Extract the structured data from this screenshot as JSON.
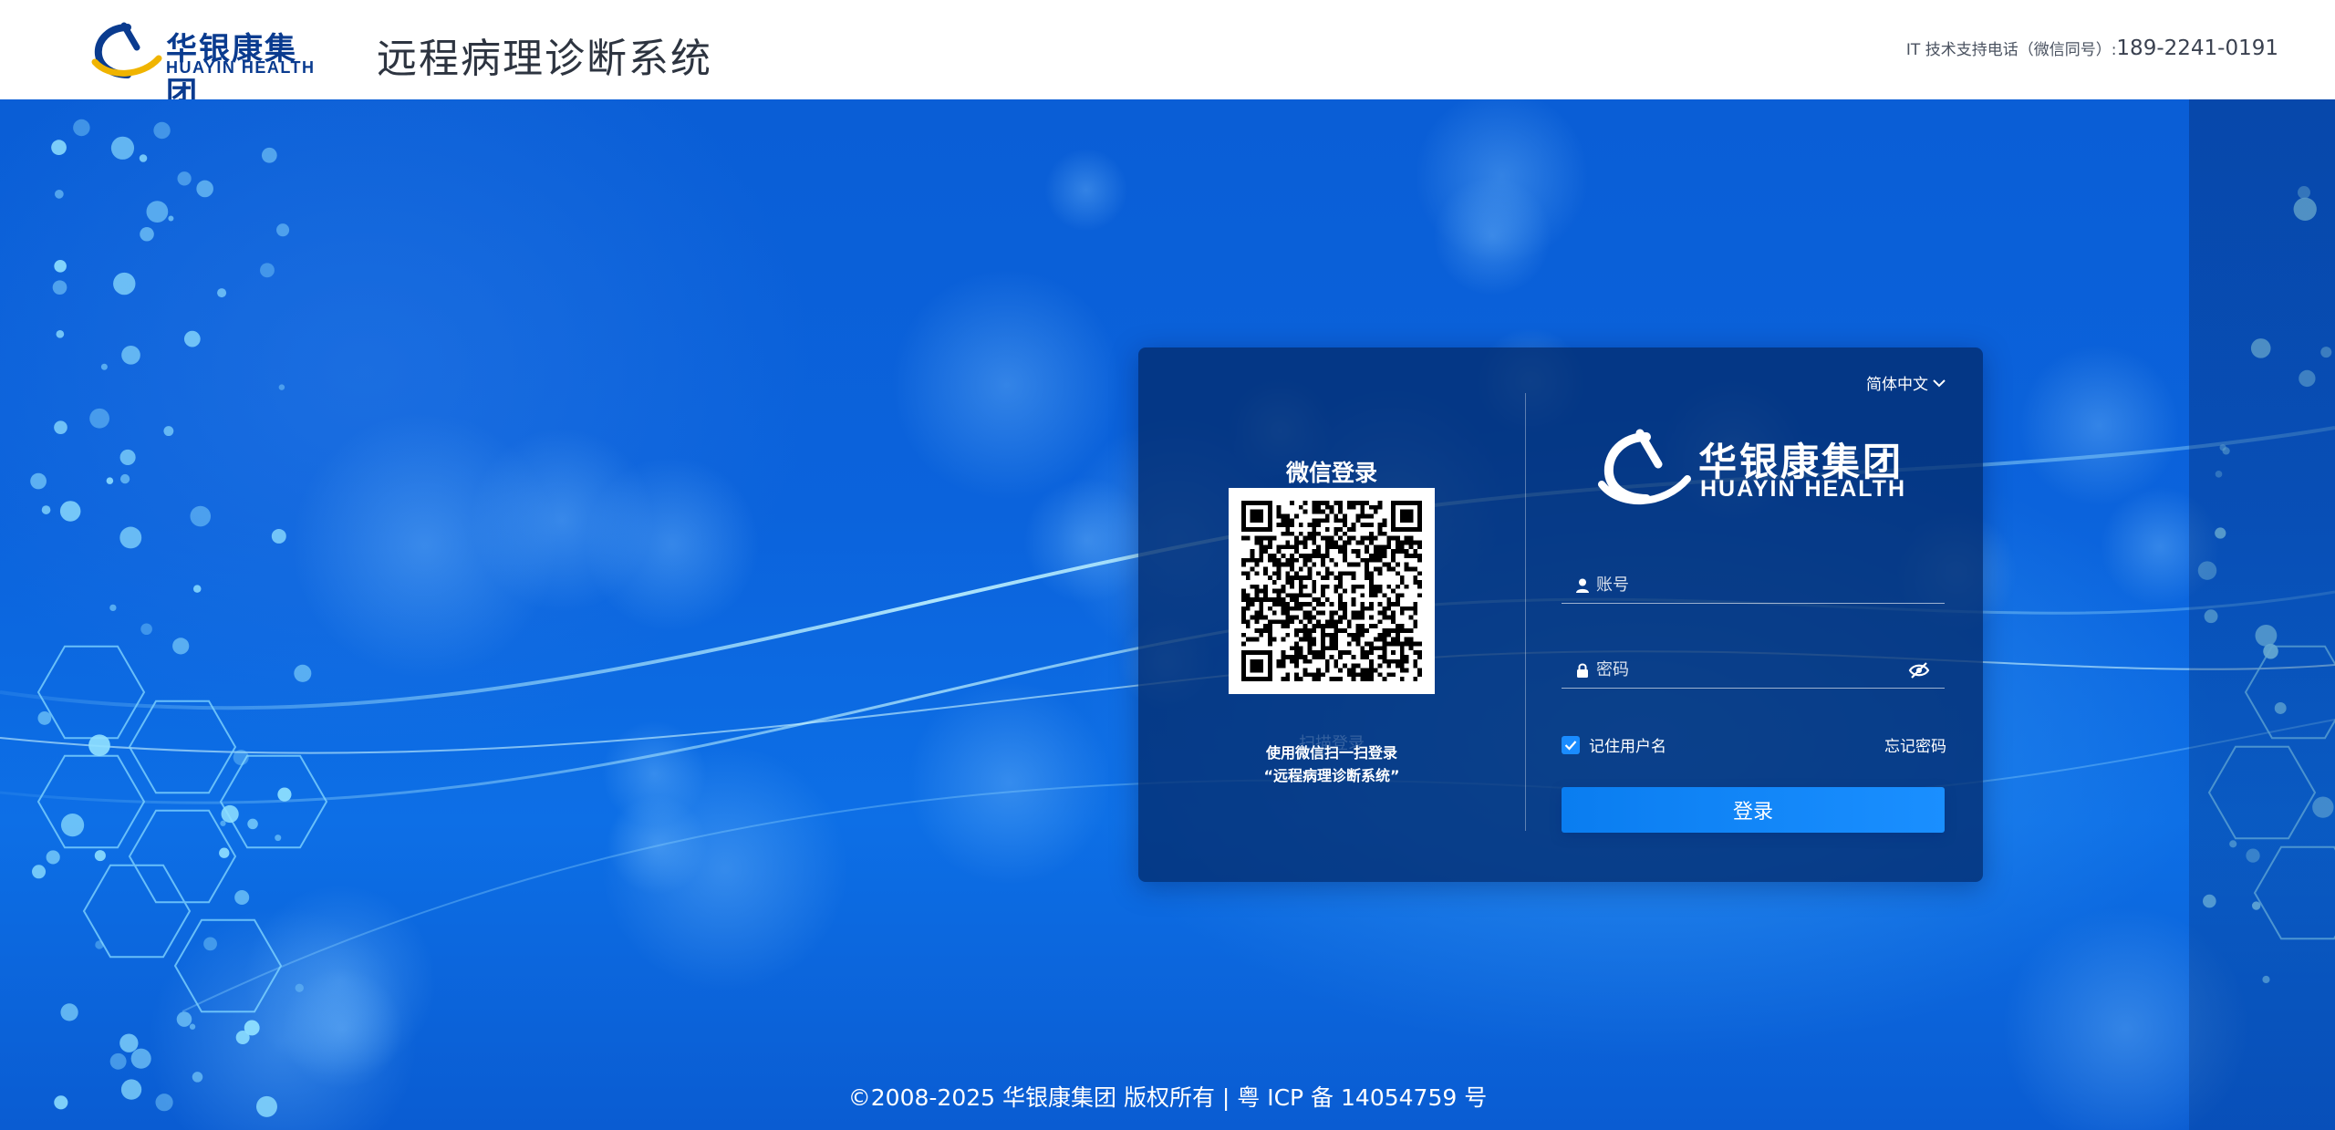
{
  "header": {
    "logo": {
      "brand_cn": "华银康集团",
      "brand_en": "HUAYIN HEALTH"
    },
    "title": "远程病理诊断系统",
    "support_label": "IT 技术支持电话（微信同号）:",
    "support_phone": "189-2241-0191"
  },
  "login_card": {
    "qr": {
      "title": "微信登录",
      "ghost_text": "扫描登录",
      "hint_line1": "使用微信扫一扫登录",
      "hint_line2": "“远程病理诊断系统”"
    },
    "language": {
      "selected": "简体中文"
    },
    "logo": {
      "brand_cn": "华银康集团",
      "brand_en": "HUAYIN HEALTH"
    },
    "form": {
      "account": {
        "placeholder": "账号",
        "value": ""
      },
      "password": {
        "placeholder": "密码",
        "value": ""
      },
      "remember_label": "记住用户名",
      "remember_checked": true,
      "forgot_label": "忘记密码",
      "login_label": "登录"
    }
  },
  "footer": {
    "copyright": "©2008-2025 华银康集团 版权所有 | 粤 ICP 备 14054759 号"
  },
  "colors": {
    "brand_navy": "#0a3b8f",
    "brand_gold": "#f0b400",
    "primary_button": "#1a8fff",
    "card_bg": "#032c6e",
    "background": "#0b63dc"
  },
  "icons": [
    "huayin-logo-icon",
    "chevron-down-icon",
    "user-icon",
    "lock-icon",
    "eye-off-icon",
    "check-icon",
    "qr-code-icon"
  ]
}
